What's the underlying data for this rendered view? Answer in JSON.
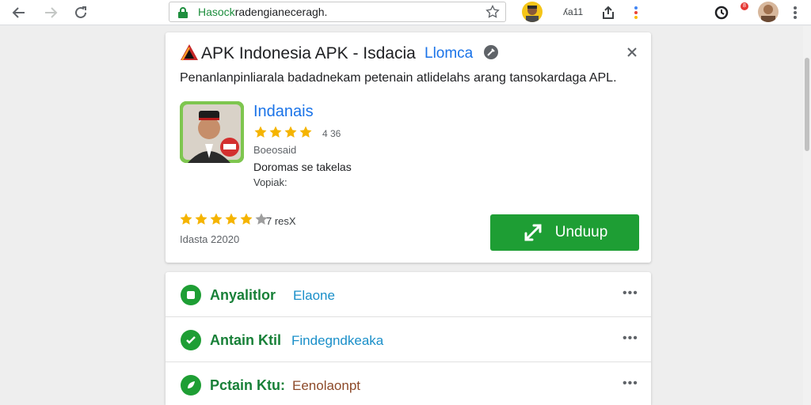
{
  "browser": {
    "url_host": "Hasock",
    "url_rest": "radengianeceragh.",
    "extension_count": "ʎa11",
    "notification_badge": "8"
  },
  "card": {
    "title": "APK Indonesia APK - Isdacia",
    "title_link": "Llomca",
    "description": "Penanlanpinliarala badadnekam petenain atlidelahs arang tansokardaga APL.",
    "app": {
      "name": "Indanais",
      "rating_small": "4 36",
      "meta1": "Boeosaid",
      "meta2": "Doromas se takelas",
      "meta3": "Vopiak:"
    },
    "rating_count": "7 resX",
    "updated": "Idasta 22020",
    "install_label": "Unduup",
    "colors": {
      "accent_green": "#1e9e34",
      "link_blue": "#1a73e8",
      "star": "#f5b400"
    }
  },
  "list": [
    {
      "title": "Anyalitlor",
      "sub": "Elaone",
      "sub_color": "#1a8fc9",
      "icon": "square-icon"
    },
    {
      "title": "Antain Ktil",
      "sub": "Findegndkeaka",
      "sub_color": "#1a8fc9",
      "icon": "check-icon"
    },
    {
      "title": "Pctain Ktu:",
      "sub": "Eenolaonpt",
      "sub_color": "#8d4a2a",
      "icon": "leaf-icon"
    }
  ]
}
